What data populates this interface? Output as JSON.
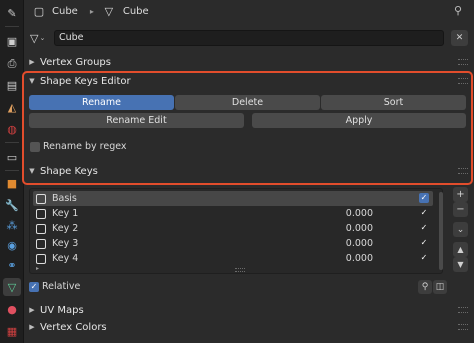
{
  "header": {
    "object_name": "Cube",
    "mesh_name": "Cube",
    "pin_icon": "pin-icon"
  },
  "data_block": {
    "name": "Cube",
    "close_icon": "close-icon"
  },
  "panels": {
    "vertex_groups": "Vertex Groups",
    "shape_keys_editor": {
      "title": "Shape Keys Editor",
      "rename": "Rename",
      "delete": "Delete",
      "sort": "Sort",
      "rename_edit": "Rename Edit",
      "apply": "Apply",
      "rename_by_regex": "Rename by regex"
    },
    "shape_keys": {
      "title": "Shape Keys",
      "keys": [
        {
          "name": "Basis",
          "value": ""
        },
        {
          "name": "Key 1",
          "value": "0.000"
        },
        {
          "name": "Key 2",
          "value": "0.000"
        },
        {
          "name": "Key 3",
          "value": "0.000"
        },
        {
          "name": "Key 4",
          "value": "0.000"
        }
      ],
      "relative_label": "Relative"
    },
    "uv_maps": "UV Maps",
    "vertex_colors": "Vertex Colors"
  },
  "colors": {
    "accent": "#4772b3",
    "highlight_box": "#e24d2c",
    "panel_bg": "#2b2b2b"
  }
}
